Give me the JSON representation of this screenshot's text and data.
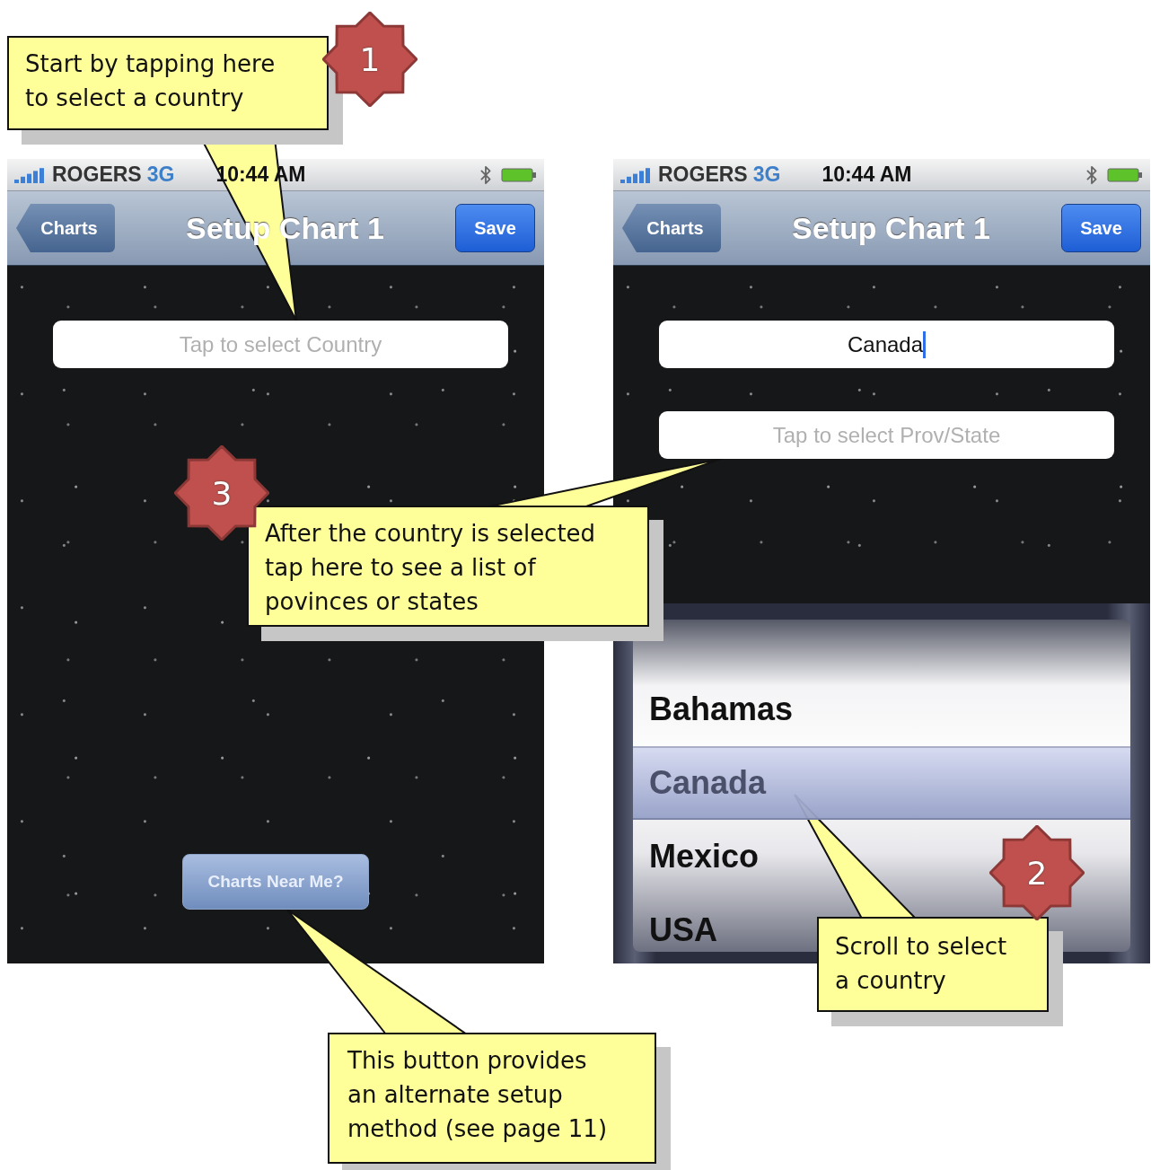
{
  "phones": [
    {
      "status": {
        "carrier": "ROGERS",
        "network": "3G",
        "time": "10:44 AM"
      },
      "nav": {
        "back": "Charts",
        "title": "Setup Chart 1",
        "action": "Save"
      },
      "fields": [
        {
          "placeholder": "Tap to select Country"
        }
      ],
      "bottom_button": "Charts Near Me?"
    },
    {
      "status": {
        "carrier": "ROGERS",
        "network": "3G",
        "time": "10:44 AM"
      },
      "nav": {
        "back": "Charts",
        "title": "Setup Chart 1",
        "action": "Save"
      },
      "fields": [
        {
          "value": "Canada",
          "focused": true
        },
        {
          "placeholder": "Tap to select Prov/State"
        }
      ],
      "picker": [
        {
          "label": "Bahamas",
          "selected": false
        },
        {
          "label": "Canada",
          "selected": true
        },
        {
          "label": "Mexico",
          "selected": false
        },
        {
          "label": "USA",
          "selected": false
        }
      ]
    }
  ],
  "callouts": [
    {
      "number": "1",
      "lines": [
        "Start by tapping here",
        "to select a country"
      ]
    },
    {
      "number": "3",
      "lines": [
        "After the country is selected",
        "tap here to see a list of",
        "povinces or states"
      ]
    },
    {
      "lines": [
        "This button provides",
        "an alternate setup",
        "method (see page 11)"
      ]
    },
    {
      "number": "2",
      "lines": [
        "Scroll to select",
        "a country"
      ]
    }
  ]
}
